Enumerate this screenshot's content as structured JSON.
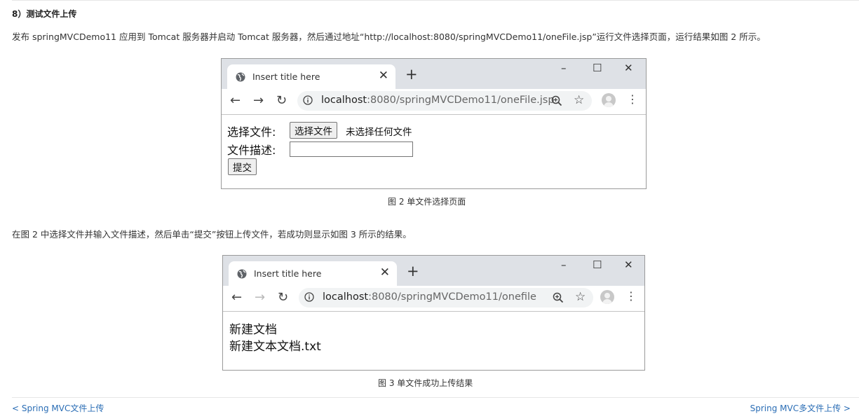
{
  "article": {
    "heading": "8）测试文件上传",
    "para1": "发布 springMVCDemo11 应用到 Tomcat 服务器并启动 Tomcat 服务器，然后通过地址“http://localhost:8080/springMVCDemo11/oneFile.jsp”运行文件选择页面，运行结果如图 2 所示。",
    "caption2": "图 2  单文件选择页面",
    "para2": "在图 2 中选择文件并输入文件描述，然后单击“提交”按钮上传文件，若成功则显示如图 3 所示的结果。",
    "caption3": "图 3  单文件成功上传结果",
    "prev_link": "< Spring MVC文件上传",
    "next_link": "Spring MVC多文件上传 >"
  },
  "browser1": {
    "tab_title": "Insert title here",
    "close_symbol": "✕",
    "newtab_symbol": "+",
    "minimize": "–",
    "maximize": "☐",
    "close_window": "✕",
    "back": "←",
    "forward": "→",
    "reload": "↻",
    "url_host": "localhost",
    "url_path": ":8080/springMVCDemo11/oneFile.jsp",
    "form": {
      "file_label": "选择文件:",
      "choose_button": "选择文件",
      "no_file_text": "未选择任何文件",
      "desc_label": "文件描述:",
      "desc_value": "",
      "submit_button": "提交"
    }
  },
  "browser2": {
    "tab_title": "Insert title here",
    "close_symbol": "✕",
    "newtab_symbol": "+",
    "minimize": "–",
    "maximize": "☐",
    "close_window": "✕",
    "back": "←",
    "forward": "→",
    "reload": "↻",
    "url_host": "localhost",
    "url_path": ":8080/springMVCDemo11/onefile",
    "result": {
      "line1": "新建文档",
      "line2": "新建文本文档.txt"
    }
  },
  "icons": {
    "globe": "globe-icon",
    "info": "info-icon",
    "zoom": "zoom-icon",
    "star": "star-icon",
    "avatar": "profile-avatar-icon",
    "menu": "kebab-menu-icon"
  },
  "colors": {
    "tabbar": "#dee1e6",
    "omnibox": "#f1f3f4",
    "link": "#2a6db5"
  }
}
